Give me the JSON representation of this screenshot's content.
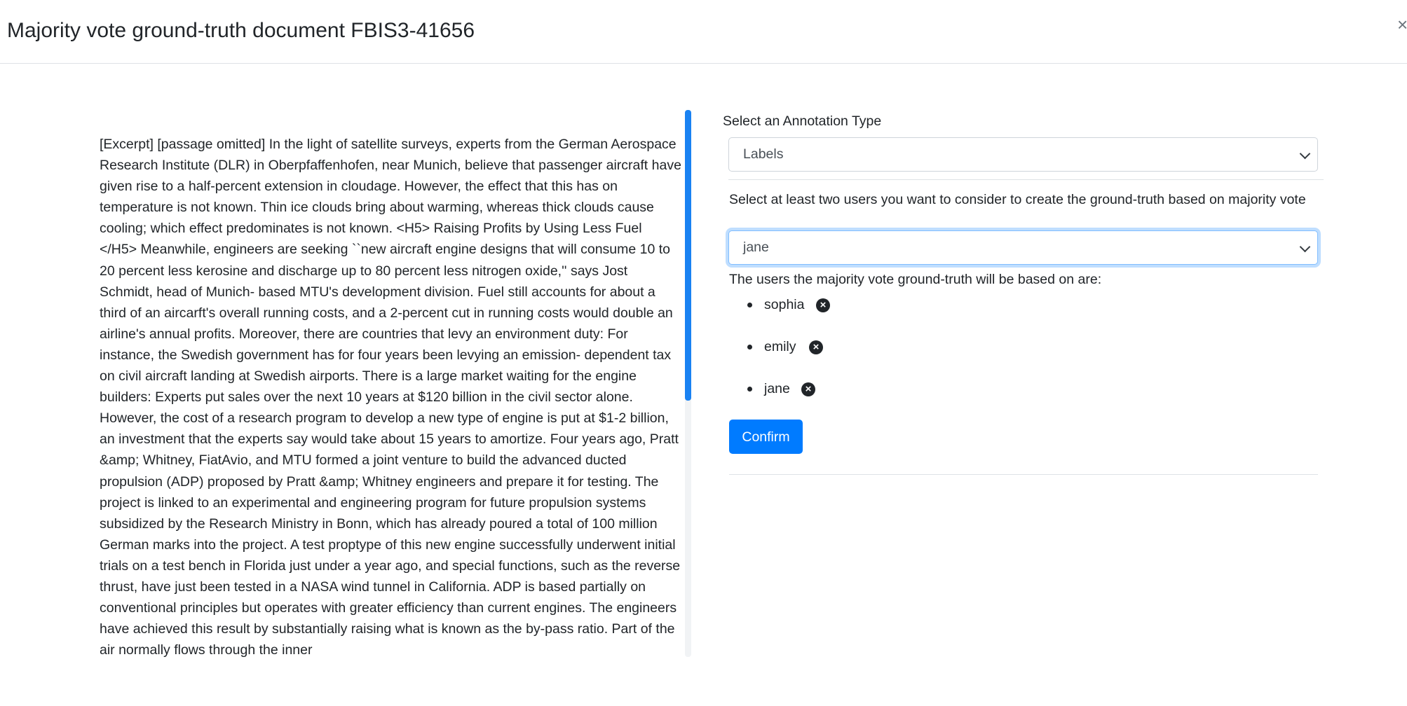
{
  "modal": {
    "title": "Majority vote ground-truth document FBIS3-41656",
    "close_symbol": "×"
  },
  "document": {
    "text": "[Excerpt] [passage omitted] In the light of satellite surveys, experts from the German Aerospace Research Institute (DLR) in Oberpfaffenhofen, near Munich, believe that passenger aircraft have given rise to a half-percent extension in cloudage. However, the effect that this has on temperature is not known. Thin ice clouds bring about warming, whereas thick clouds cause cooling; which effect predominates is not known. <H5> Raising Profits by Using Less Fuel </H5> Meanwhile, engineers are seeking ``new aircraft engine designs that will consume 10 to 20 percent less kerosine and discharge up to 80 percent less nitrogen oxide,'' says Jost Schmidt, head of Munich- based MTU's development division. Fuel still accounts for about a third of an aircarft's overall running costs, and a 2-percent cut in running costs would double an airline's annual profits. Moreover, there are countries that levy an environment duty: For instance, the Swedish government has for four years been levying an emission- dependent tax on civil aircraft landing at Swedish airports. There is a large market waiting for the engine builders: Experts put sales over the next 10 years at $120 billion in the civil sector alone. However, the cost of a research program to develop a new type of engine is put at $1-2 billion, an investment that the experts say would take about 15 years to amortize. Four years ago, Pratt &amp; Whitney, FiatAvio, and MTU formed a joint venture to build the advanced ducted propulsion (ADP) proposed by Pratt &amp; Whitney engineers and prepare it for testing. The project is linked to an experimental and engineering program for future propulsion systems subsidized by the Research Ministry in Bonn, which has already poured a total of 100 million German marks into the project. A test proptype of this new engine successfully underwent initial trials on a test bench in Florida just under a year ago, and special functions, such as the reverse thrust, have just been tested in a NASA wind tunnel in California. ADP is based partially on conventional principles but operates with greater efficiency than current engines. The engineers have achieved this result by substantially raising what is known as the by-pass ratio. Part of the air normally flows through the inner"
  },
  "annotation": {
    "type_label": "Select an Annotation Type",
    "type_value": "Labels",
    "users_prompt": "Select at least two users you want to consider to create the ground-truth based on majority vote",
    "users_select_value": "jane",
    "selected_heading": "The users the majority vote ground-truth will be based on are:",
    "selected_users": [
      "sophia",
      "emily",
      "jane"
    ],
    "remove_icon": "x-circle-icon",
    "confirm_label": "Confirm"
  },
  "colors": {
    "primary": "#007bff",
    "scrollbar_thumb": "#1a82f2",
    "focus_border": "#80bdff"
  }
}
